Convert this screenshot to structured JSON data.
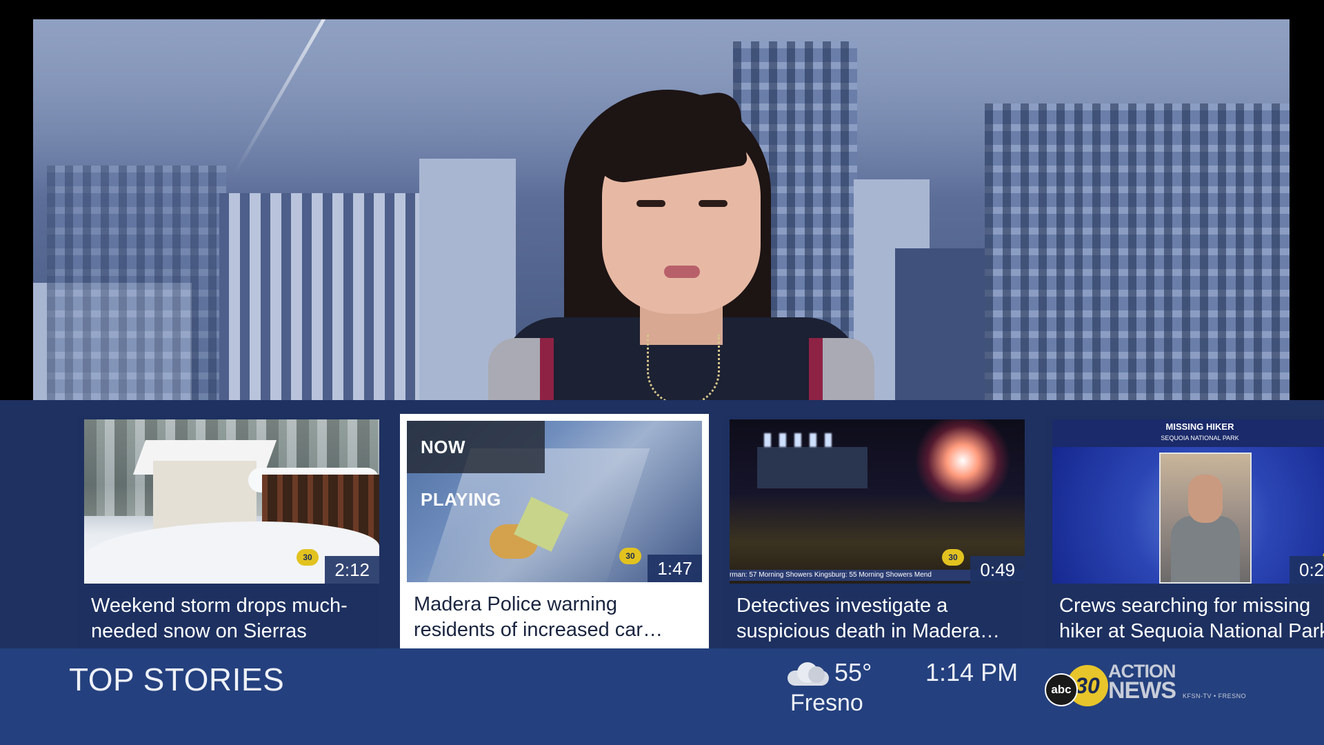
{
  "carousel": {
    "items": [
      {
        "caption": "Weekend storm drops much-needed snow on Sierras",
        "duration": "2:12",
        "now_playing": false
      },
      {
        "caption": "Madera Police warning residents of increased car burglaries",
        "duration": "1:47",
        "now_playing": true
      },
      {
        "caption": "Detectives investigate a suspicious death in Madera County",
        "duration": "0:49",
        "now_playing": false
      },
      {
        "caption": "Crews searching for missing hiker at Sequoia National Park",
        "duration": "0:2",
        "now_playing": false
      }
    ],
    "now_playing_label": "NOW PLAYING",
    "thumb4_banner": "MISSING HIKER",
    "thumb4_sub": "SEQUOIA NATIONAL PARK",
    "thumb3_ticker": "rman: 57 Morning Showers   Kingsburg: 55 Morning Showers   Mend"
  },
  "footer": {
    "section_title": "TOP STORIES",
    "weather": {
      "icon": "cloudy-icon",
      "temperature": "55°",
      "city": "Fresno"
    },
    "time": "1:14 PM",
    "logo": {
      "abc": "abc",
      "channel": "30",
      "line1": "ACTION",
      "line2": "NEWS",
      "callsign": "KFSN-TV • FRESNO"
    }
  },
  "colors": {
    "carousel_bg": "#1f3161",
    "footer_bg": "#24407e",
    "active_card": "#ffffff",
    "accent": "#e8c52a"
  }
}
